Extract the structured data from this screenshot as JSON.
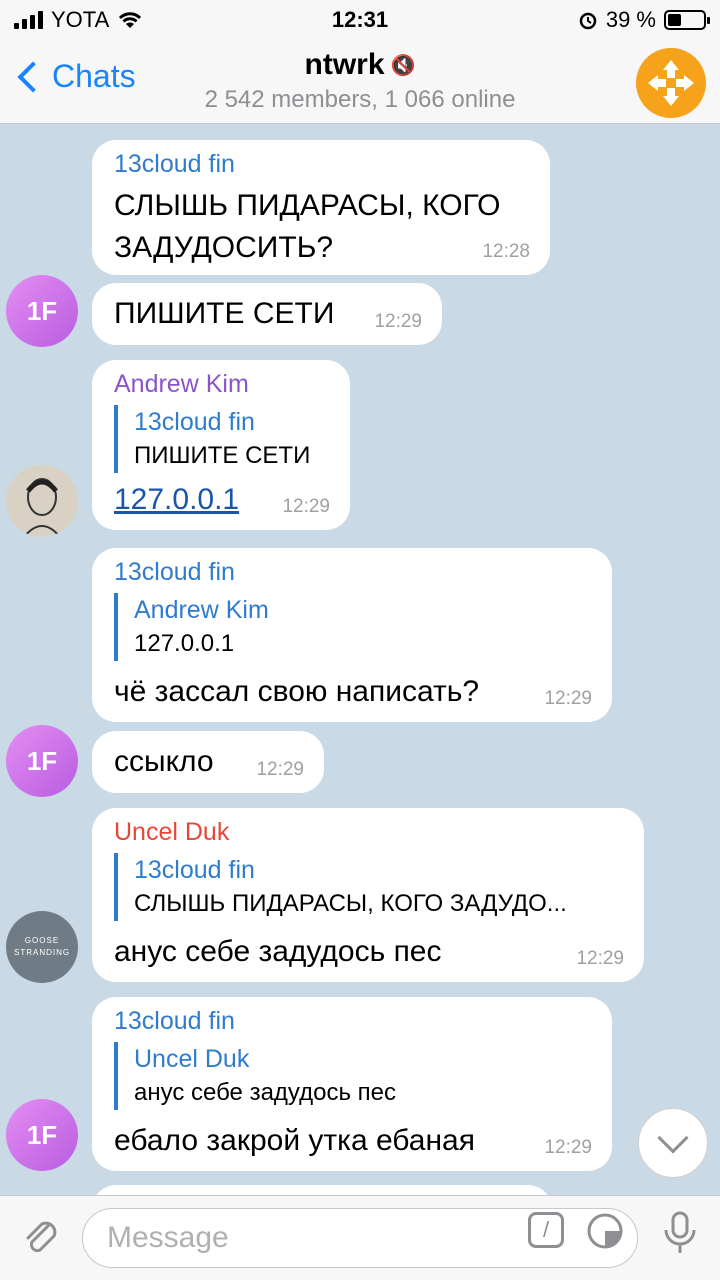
{
  "status_bar": {
    "carrier": "YOTA",
    "time": "12:31",
    "battery": "39 %",
    "battery_level": 0.39
  },
  "header": {
    "back_label": "Chats",
    "title": "ntwrk",
    "subtitle": "2 542 members, 1 066 online"
  },
  "messages": [
    {
      "sender": "13cloud fin",
      "text": "СЛЫШЬ ПИДАРАСЫ, КОГО ЗАДУДОСИТЬ?",
      "time": "12:28"
    },
    {
      "text": "ПИШИТЕ СЕТИ",
      "time": "12:29",
      "avatar": "1F"
    },
    {
      "sender": "Andrew Kim",
      "reply_name": "13cloud fin",
      "reply_text": "ПИШИТЕ СЕТИ",
      "link": "127.0.0.1",
      "time": "12:29"
    },
    {
      "sender": "13cloud fin",
      "reply_name": "Andrew Kim",
      "reply_text": "127.0.0.1",
      "text": "чё зассал свою написать?",
      "time": "12:29"
    },
    {
      "text": "ссыкло",
      "time": "12:29",
      "avatar": "1F"
    },
    {
      "sender": "Uncel Duk",
      "reply_name": "13cloud fin",
      "reply_text": "СЛЫШЬ ПИДАРАСЫ, КОГО ЗАДУДО...",
      "text": "анус себе задудось пес",
      "time": "12:29",
      "avatar_text": "GOOSE STRANDING"
    },
    {
      "sender": "13cloud fin",
      "reply_name": "Uncel Duk",
      "reply_text": "анус себе задудось пес",
      "text": "ебало закрой утка ебаная",
      "time": "12:29",
      "avatar": "1F"
    }
  ],
  "input": {
    "placeholder": "Message"
  },
  "colors": {
    "accent": "#1a84ff",
    "group_avatar": "#f7a21b",
    "background": "#c9d9e6"
  }
}
